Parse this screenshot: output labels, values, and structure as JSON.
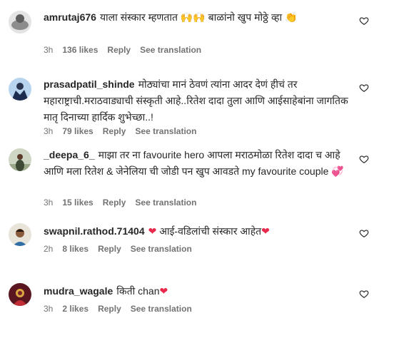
{
  "comments": [
    {
      "username": "amrutaj676",
      "text_parts": [
        "याला संस्कार म्हणतात ",
        "🙌🙌",
        " बाळांनो खुप मोठ्ठे व्हा ",
        "👏"
      ],
      "time": "3h",
      "likes": "136 likes",
      "reply": "Reply",
      "translate": "See translation",
      "avatar_colors": [
        "#d9d9d9",
        "#7a7a7a"
      ],
      "heart_icon": "heart-outline-icon"
    },
    {
      "username": "prasadpatil_shinde",
      "text": "मोठ्यांचा मानं ठेवणं त्यांना आदर देणं हीचं तर महाराष्ट्राची.मराठवाड्याची संस्कृती आहे..रितेश दादा तुला आणि आईसाहेबांना जागतिक मातृ दिनाच्या हार्दिक शुभेच्छा..!",
      "time": "3h",
      "likes": "79 likes",
      "reply": "Reply",
      "translate": "See translation",
      "avatar_colors": [
        "#b9d4ee",
        "#1c2d4f"
      ],
      "heart_icon": "heart-outline-icon"
    },
    {
      "username": "_deepa_6_",
      "text_parts": [
        "माझा तर ना favourite hero आपला मराठमोळा रितेश दादा च आहे आणि मला रितेश & जेनेलिया ची जोडी पन खुप आवडते my favourite couple ",
        "💞"
      ],
      "time": "3h",
      "likes": "15 likes",
      "reply": "Reply",
      "translate": "See translation",
      "avatar_colors": [
        "#cfd6c4",
        "#3d4a35"
      ],
      "heart_icon": "heart-outline-icon"
    },
    {
      "username": "swapnil.rathod.71404",
      "text_parts": [
        "❤",
        " आई-वडिलांची संस्कार आहेत",
        "❤"
      ],
      "time": "2h",
      "likes": "8 likes",
      "reply": "Reply",
      "translate": "See translation",
      "avatar_colors": [
        "#e9e4da",
        "#2f6fa5"
      ],
      "heart_icon": "heart-outline-icon"
    },
    {
      "username": "mudra_wagale",
      "text_parts": [
        "किती chan",
        "❤"
      ],
      "time": "3h",
      "likes": "2 likes",
      "reply": "Reply",
      "translate": "See translation",
      "avatar_colors": [
        "#7b1f2a",
        "#d9a640"
      ],
      "heart_icon": "heart-outline-icon"
    }
  ]
}
